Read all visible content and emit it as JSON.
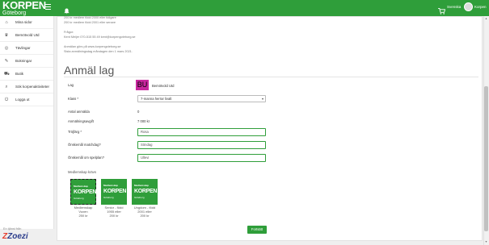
{
  "header": {
    "logo_word": "KORPEN",
    "logo_city": "Göteborg",
    "language": "Svenska",
    "user": "Korpen"
  },
  "sidebar": {
    "items": [
      {
        "label": "Mina sidor",
        "icon": "home-icon",
        "glyph": "⌂"
      },
      {
        "label": "Bemötvold Utd",
        "icon": "team-icon",
        "glyph": "♛"
      },
      {
        "label": "Tävlingar",
        "icon": "trophy-icon",
        "glyph": "◎"
      },
      {
        "label": "Bokningar",
        "icon": "ticket-icon",
        "glyph": "✎"
      },
      {
        "label": "Butik",
        "icon": "cart-icon",
        "glyph": "⛟"
      },
      {
        "label": "Sök korpenaktiviteter",
        "icon": "search-icon",
        "glyph": "⌕"
      },
      {
        "label": "Logga ut",
        "icon": "power-icon",
        "glyph": "⏻"
      }
    ],
    "powered_by": "En tjänst från",
    "zoezi": "Zoezi"
  },
  "info": {
    "line1": "200 kr medlem född 2000 eller tidigare",
    "line2": "200 kr medlem född 2001 eller senare",
    "contact_heading": "Frågor:",
    "contact_line": "Kent Meijer 070-515 55 49 kent@korpengoteborg.se",
    "register_line1": "Anmälan görs på www.korpengoteborg.se",
    "register_line2": "Sista anmälningsdag måndagen den 1 mars 2021."
  },
  "form": {
    "heading": "Anmäl lag",
    "team_label": "Lag",
    "team_badge": "BU",
    "team_name": "Bemötvold Utd",
    "class_label": "Klass *",
    "class_value": "7-manna herrar livalt",
    "count_label": "Antal anmälda",
    "count_value": "0",
    "fee_label": "Anmälningsavgift",
    "fee_value": "7 000 kr",
    "shirt_label": "Tröjfärg *",
    "shirt_value": "Rosa",
    "match_label": "Önskemål matchdag?",
    "match_value": "Söndag",
    "place_label": "Önskemål om spelplan?",
    "place_value": "Ullevi",
    "membership_title": "Medlemskap krävs",
    "tiles": [
      {
        "small": "Medlemskap",
        "word": "KORPEN",
        "city": "Göteborg",
        "caption1": "Medlemskap",
        "caption2": "Vuxen",
        "caption3": "250 kr"
      },
      {
        "small": "Medlemskap",
        "word": "KORPEN",
        "city": "Göteborg",
        "caption1": "Senior - född",
        "caption2": "1955 eller",
        "caption3": "200 kr"
      },
      {
        "small": "Medlemskap",
        "word": "KORPEN",
        "city": "Göteborg",
        "caption1": "Ungdom - född",
        "caption2": "2001 eller",
        "caption3": "200 kr"
      }
    ],
    "submit_label": "Fortsätt"
  },
  "colors": {
    "brand_green": "#2f9e3a",
    "badge_pink": "#c8279e"
  }
}
